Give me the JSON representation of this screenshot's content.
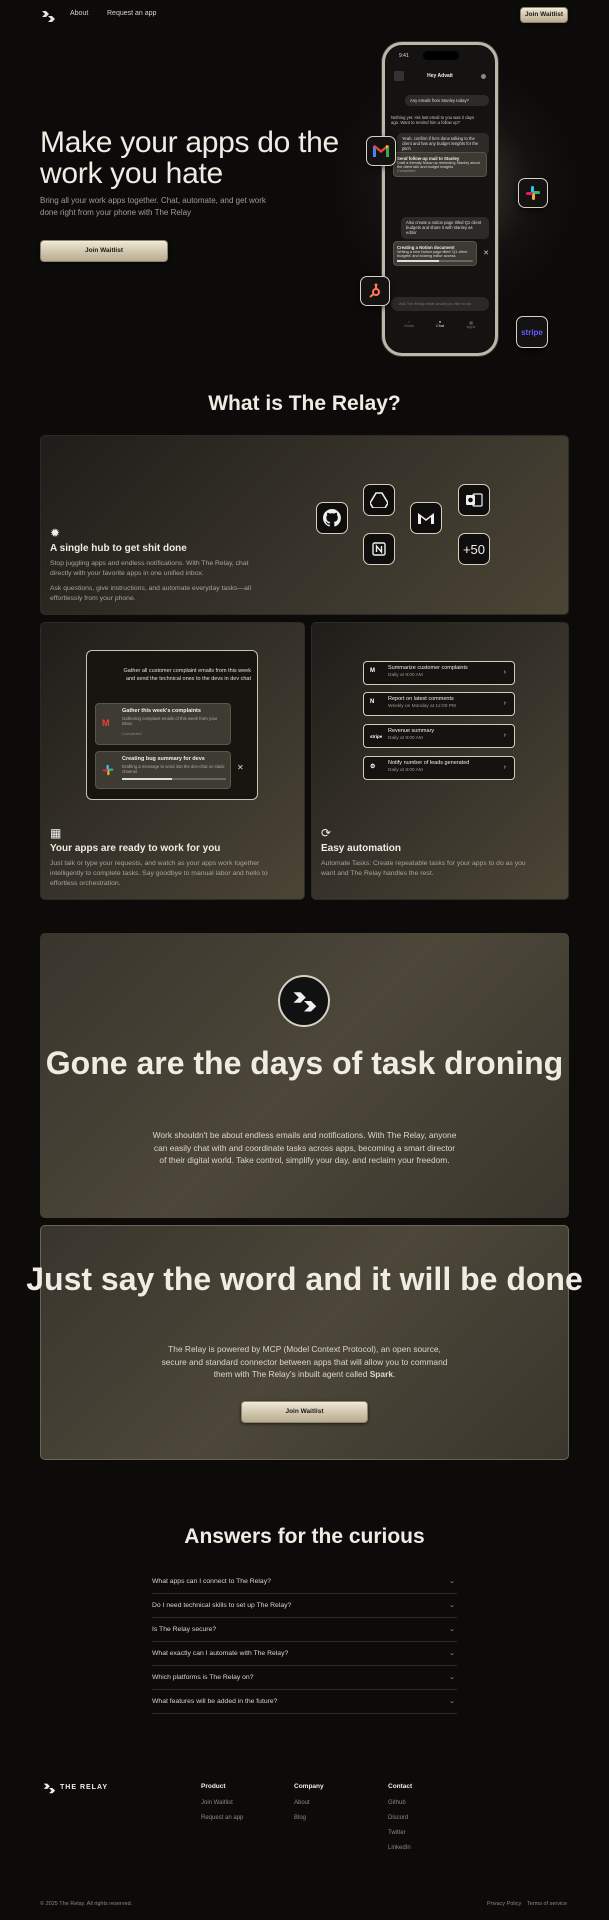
{
  "nav": {
    "about": "About",
    "request": "Request an app",
    "cta": "Join Waitlist"
  },
  "hero": {
    "title": "Make your apps do the work you hate",
    "subtitle": "Bring all your work apps together. Chat, automate, and get work done right from your phone with The Relay",
    "cta": "Join Waitlist"
  },
  "phone": {
    "time": "9:41",
    "header": "Hey Advait",
    "msg1": "Any emails from Stanley today?",
    "reply1": "Nothing yet. His last email to you was 2 days ago. Want to remind him a follow up?",
    "msg2": "Yeah, confirm if he's done talking to the client and has any budget insights for the pitch",
    "task1_title": "Send follow-up mail to Stanley",
    "task1_text": "Draft a friendly follow up reminding Stanley about the client talk and budget insights",
    "task1_status": "Completed",
    "msg3": "Also create a notion page titled Q1 client budgets and share it with stanley as editor",
    "task2_title": "Creating a Notion document",
    "task2_text": "Writing a new Notion page titled 'Q1 client budgets' and sharing editor access",
    "input": "Ask The Relay what would you like to do",
    "nav_home": "Home",
    "nav_chat": "Chat",
    "nav_apps": "Apps",
    "stripe": "stripe"
  },
  "what": {
    "title": "What is The Relay?",
    "hub_title": "A single hub to get shit done",
    "hub_text1": "Stop juggling apps and endless notifications. With The Relay, chat directly with your favorite apps in one unified inbox.",
    "hub_text2": "Ask questions, give instructions, and automate everyday tasks—all effortlessly from your phone.",
    "plus": "+50",
    "work_prompt": "Gather all customer complaint emails from this week and send the technical ones to the devs in dev chat",
    "work_task1": "Gather this week's complaints",
    "work_task1_sub": "Gathering complaint emails of this week from your inbox",
    "work_task1_status": "Completed",
    "work_task2": "Creating bug summary for devs",
    "work_task2_sub": "Drafting a message to send into the dev-chat on slack channel",
    "work_title": "Your apps are ready to work for you",
    "work_text": "Just talk or type your requests, and watch as your apps work together intelligently to complete tasks. Say goodbye to manual labor and hello to effortless orchestration.",
    "auto_title": "Easy automation",
    "auto_text": "Automate Tasks: Create repeatable tasks for your apps to do as you want and The Relay handles the rest.",
    "auto_items": [
      {
        "title": "Summarize customer complaints",
        "sub": "Daily at 9:00 AM"
      },
      {
        "title": "Report on latest comments",
        "sub": "Weekly on Monday at 12:00 PM"
      },
      {
        "title": "Revenue summary",
        "sub": "Daily at 9:00 AM"
      },
      {
        "title": "Notify number of leads generated",
        "sub": "Daily at 8:00 AM"
      }
    ]
  },
  "gone": {
    "title": "Gone are the days of task droning",
    "text": "Work shouldn't be about endless emails and notifications. With The Relay, anyone can easily chat with and coordinate tasks across apps, becoming a smart director of their digital world. Take control, simplify your day, and reclaim your freedom."
  },
  "say": {
    "title": "Just say the word and it will be done",
    "text1": "The Relay is powered by MCP (Model Context Protocol), an open source, secure and standard connector between apps that will allow you to command them with The Relay's inbuilt agent called ",
    "spark": "Spark",
    "text_end": ".",
    "cta": "Join Waitlist"
  },
  "faq": {
    "title": "Answers for the curious",
    "items": [
      "What apps can I connect to The Relay?",
      "Do I need technical skills to set up The Relay?",
      "Is The Relay secure?",
      "What exactly can I automate with The Relay?",
      "Which platforms is The Relay on?",
      "What features will be added in the future?"
    ]
  },
  "footer": {
    "brand": "THE RELAY",
    "product": "Product",
    "p1": "Join Waitlist",
    "p2": "Request an app",
    "company": "Company",
    "c1": "About",
    "c2": "Blog",
    "contact": "Contact",
    "k1": "Github",
    "k2": "Discord",
    "k3": "Twitter",
    "k4": "LinkedIn",
    "copyright": "© 2025 The Relay. All rights reserved.",
    "privacy": "Privacy Policy",
    "terms": "Terms of service"
  }
}
